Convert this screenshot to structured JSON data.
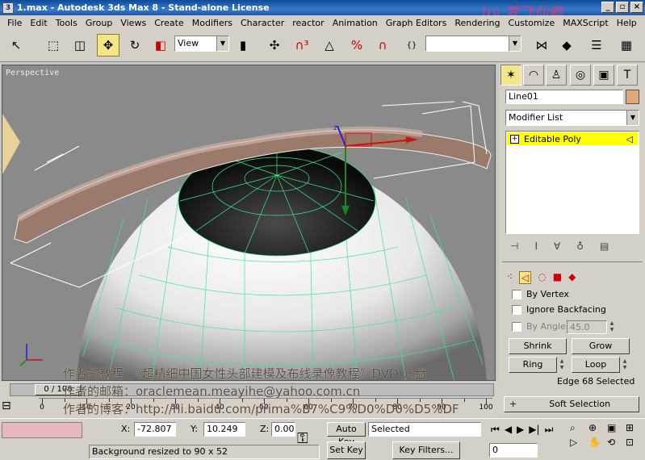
{
  "title": {
    "text": "1.max - Autodesk 3ds Max 8 - Stand-alone License",
    "icon": "3dsmax-icon"
  },
  "watermark": "by 梦飞仙鹤",
  "menu": [
    "File",
    "Edit",
    "Tools",
    "Group",
    "Views",
    "Create",
    "Modifiers",
    "Character",
    "reactor",
    "Animation",
    "Graph Editors",
    "Rendering",
    "Customize",
    "MAXScript",
    "Help"
  ],
  "toolbar": {
    "ref_coord": "View",
    "named_selection": ""
  },
  "viewport": {
    "label": "Perspective"
  },
  "panel": {
    "object_name": "Line01",
    "object_color": "#e2a77a",
    "modifier_list": "Modifier List",
    "stack_item": "Editable Poly",
    "by_vertex": "By Vertex",
    "ignore_backfacing": "Ignore Backfacing",
    "by_angle": "By Angle:",
    "angle_value": "45.0",
    "shrink": "Shrink",
    "grow": "Grow",
    "ring": "Ring",
    "loop": "Loop",
    "selection_info": "Edge 68 Selected",
    "soft_selection": "Soft Selection",
    "soft_plus": "+"
  },
  "timeline": {
    "frame": "0 / 100",
    "ticks": [
      "0",
      "10",
      "20",
      "30",
      "40",
      "50",
      "60",
      "70",
      "80",
      "90",
      "100"
    ]
  },
  "status": {
    "x_label": "X:",
    "x_value": "-72.807",
    "y_label": "Y:",
    "y_value": "10.249",
    "z_label": "Z:",
    "z_value": "0.00",
    "auto_key": "Auto Key",
    "selected": "Selected",
    "set_key": "Set Key",
    "key_filters": "Key Filters...",
    "frame_field": "0",
    "prompt": "Background resized to 90 x 52"
  },
  "overlay": {
    "line1": "作者的教程：《超精细中国女性头部建模及布线录像教程》DVD 光盘",
    "line2": "作者的邮箱：oraclemean.meayihe@yahoo.com.cn",
    "line3": "作者的博客：http://hi.baidu.com/prima%B7%C9%D0%D0%D5%DF"
  }
}
